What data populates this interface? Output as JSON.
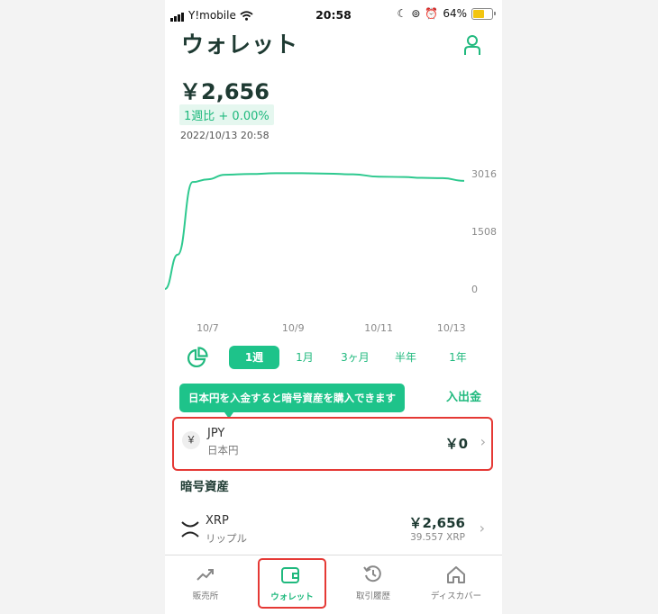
{
  "status_bar": {
    "carrier": "Y!mobile",
    "time": "20:58",
    "battery": "64%",
    "battery_level": 0.64
  },
  "header": {
    "title": "ウォレット"
  },
  "summary": {
    "balance": "￥2,656",
    "change": "1週比 + 0.00%",
    "timestamp": "2022/10/13 20:58"
  },
  "chart_data": {
    "type": "line",
    "x_tick_labels": [
      "10/7",
      "10/9",
      "10/11",
      "10/13"
    ],
    "y_tick_labels": [
      "3016",
      "1508",
      "0"
    ],
    "ylim": [
      0,
      3016
    ],
    "x": [
      0,
      0.3,
      0.65,
      1,
      1.4,
      2,
      2.6,
      3.2,
      3.8,
      4.4,
      5,
      5.6,
      6,
      6.5,
      7
    ],
    "values": [
      0,
      900,
      2800,
      2870,
      2990,
      3010,
      3030,
      3030,
      3020,
      3000,
      2940,
      2930,
      2910,
      2900,
      2830
    ],
    "color": "#2ec98f",
    "grid": false
  },
  "periods": {
    "items": [
      "1週",
      "1月",
      "3ヶ月",
      "半年",
      "1年"
    ],
    "selected": "1週"
  },
  "tooltip": {
    "text": "日本円を入金すると暗号資産を購入できます"
  },
  "deposit_button": {
    "label": "入出金"
  },
  "fiat": {
    "symbol": "￥",
    "code": "JPY",
    "name": "日本円",
    "value": "￥0"
  },
  "crypto_section": {
    "title": "暗号資産"
  },
  "crypto": [
    {
      "code": "XRP",
      "name": "リップル",
      "value": "￥2,656",
      "amount": "39.557 XRP"
    }
  ],
  "tabs": [
    {
      "label": "販売所",
      "icon": "trend-up-icon"
    },
    {
      "label": "ウォレット",
      "icon": "wallet-icon",
      "active": true
    },
    {
      "label": "取引履歴",
      "icon": "history-icon"
    },
    {
      "label": "ディスカバー",
      "icon": "home-icon"
    }
  ],
  "colors": {
    "accent": "#1ec38a",
    "highlight": "#e53935",
    "text_dark": "#1e3a32"
  }
}
